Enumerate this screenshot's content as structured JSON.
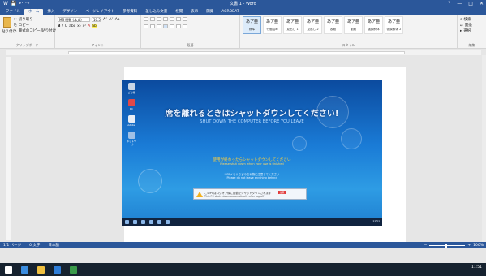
{
  "window": {
    "doc_title": "文書 1 - Word",
    "controls": [
      "?",
      "—",
      "□",
      "✕"
    ]
  },
  "qat": [
    "W",
    "💾",
    "↶",
    "↷"
  ],
  "tabs": [
    "ファイル",
    "ホーム",
    "挿入",
    "デザイン",
    "ページレイアウト",
    "参考資料",
    "差し込み文書",
    "校閲",
    "表示",
    "開発",
    "ACROBAT"
  ],
  "ribbon": {
    "clipboard": {
      "paste": "貼り付け",
      "cut": "切り取り",
      "copy": "コピー",
      "format_painter": "書式のコピー/貼り付け",
      "label": "クリップボード"
    },
    "font": {
      "font_name": "MS 明朝 (本文)",
      "font_size": "10.5",
      "label": "フォント"
    },
    "paragraph": {
      "label": "段落"
    },
    "styles": {
      "label": "スタイル",
      "tiles": [
        {
          "sample": "あア亜",
          "name": "標準"
        },
        {
          "sample": "あア亜",
          "name": "行間詰め"
        },
        {
          "sample": "あア亜",
          "name": "見出し 1"
        },
        {
          "sample": "あア亜",
          "name": "見出し 2"
        },
        {
          "sample": "あア亜",
          "name": "表題"
        },
        {
          "sample": "あア亜",
          "name": "副題"
        },
        {
          "sample": "あア亜",
          "name": "強調斜体"
        },
        {
          "sample": "あア亜",
          "name": "強調斜体 2"
        }
      ]
    },
    "editing": {
      "find": "検索",
      "replace": "置換",
      "select": "選択",
      "label": "編集"
    }
  },
  "embedded_screenshot": {
    "desktop_icons": [
      "ごみ箱",
      "PC",
      "Adobe",
      "ネットワーク"
    ],
    "jp_title": "席を離れるときはシャットダウンしてください!",
    "en_title": "SHUT DOWN THE COMPUTER BEFORE YOU LEAVE",
    "orange_line1": "使用が終わったらシャットダウンしてください",
    "orange_line2": "Please shut down when your use is finished",
    "white_line1": "USBメモリなどの忘れ物に注意してください",
    "white_line2": "Please do not leave anything behind",
    "notice_line1": "このPCはログオフ後に自動でシャットダウンされます",
    "notice_line2": "This PC shuts down automatically after log off",
    "notice_badge": "注意",
    "clock": "11:51"
  },
  "statusbar": {
    "page": "1/1 ページ",
    "words": "0 文字",
    "lang": "日本語",
    "zoom": "100%"
  },
  "taskbar": {
    "clock": "11:51"
  },
  "colors": {
    "accent": "#2b579a",
    "taskbar": "#16222f"
  }
}
